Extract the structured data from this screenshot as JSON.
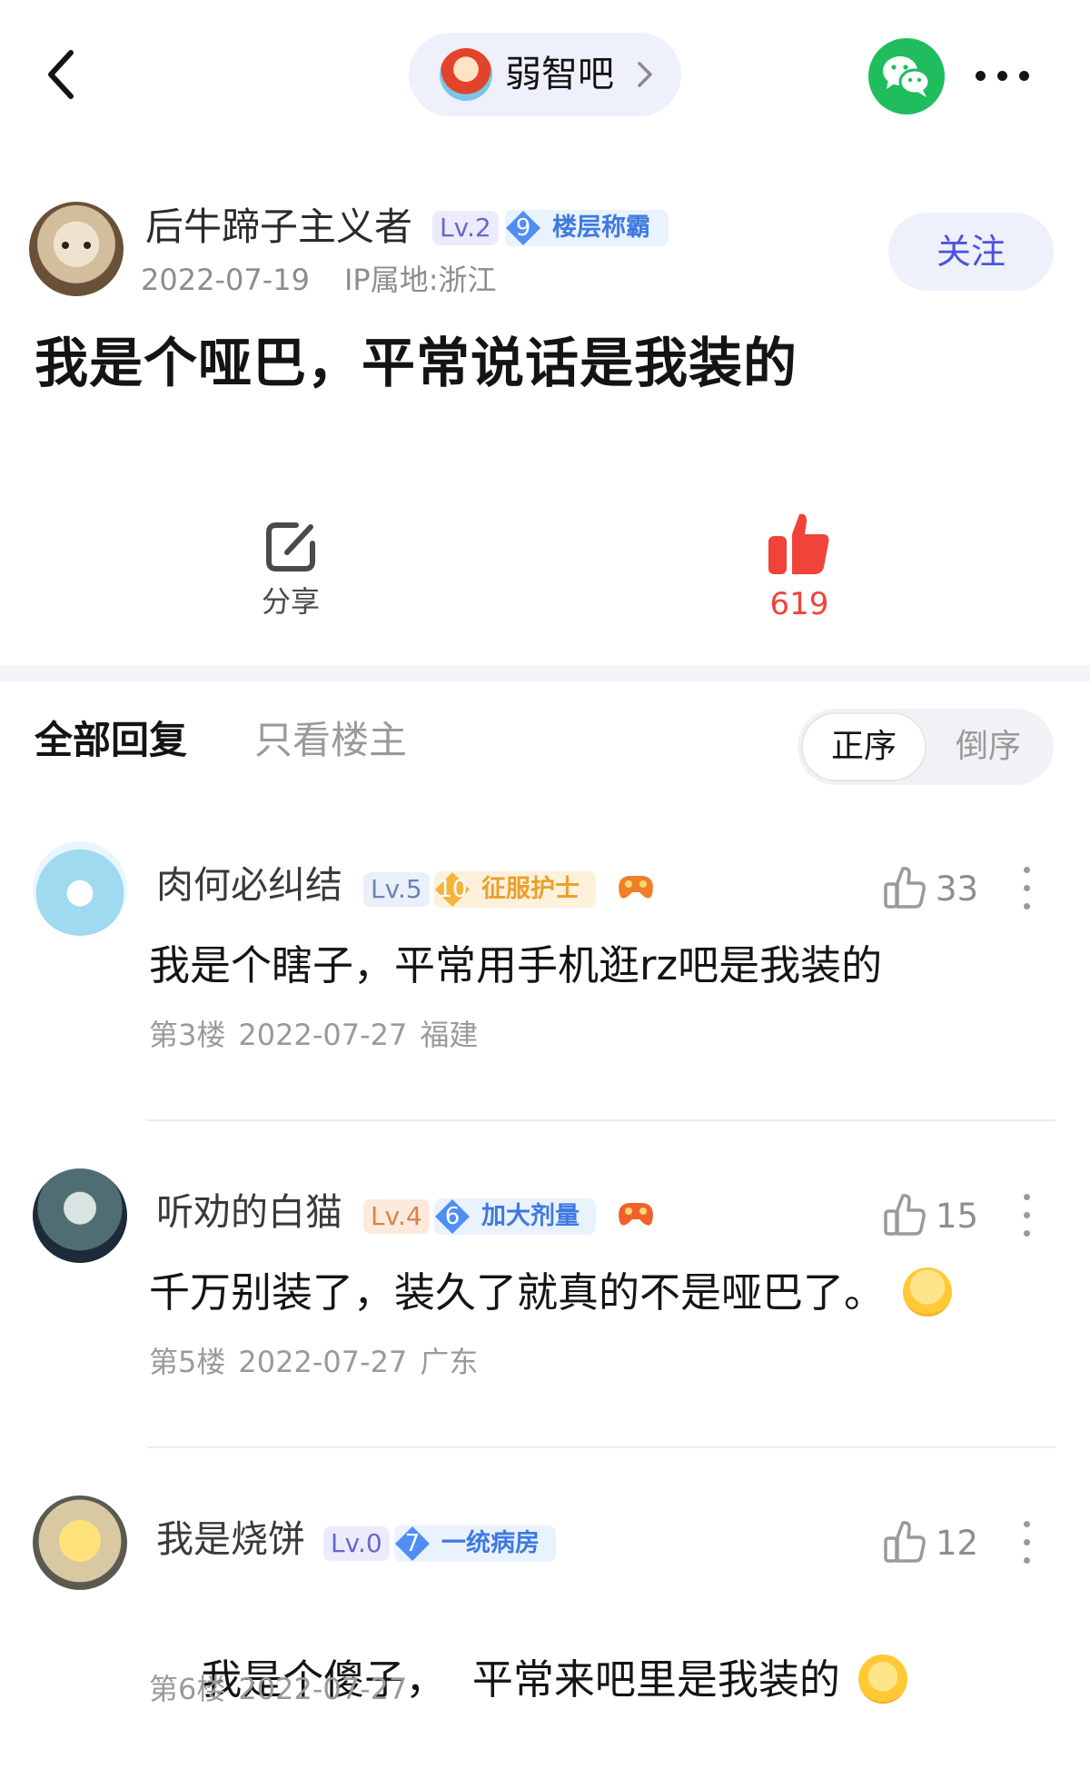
{
  "header": {
    "forum_name": "弱智吧",
    "icons": {
      "back": "back-arrow-icon",
      "share": "wechat-icon",
      "more": "more-dots-icon",
      "forum_chevron": "chevron-right-icon"
    }
  },
  "post": {
    "author": {
      "name": "后牛蹄子主义者",
      "level": "Lv.2",
      "badge_number": "9",
      "badge_title": "楼层称霸",
      "date": "2022-07-19",
      "ip_location": "IP属地:浙江"
    },
    "follow_label": "关注",
    "title": "我是个哑巴，平常说话是我装的",
    "share_label": "分享",
    "like_count": "619"
  },
  "tabs": {
    "all": "全部回复",
    "op_only": "只看楼主"
  },
  "sort": {
    "asc": "正序",
    "desc": "倒序",
    "selected": "正序"
  },
  "comments": [
    {
      "name": "肉何必纠结",
      "level": "Lv.5",
      "badge_number": "10",
      "badge_title": "征服护士",
      "likes": "33",
      "text": "我是个瞎子，平常用手机逛rz吧是我装的",
      "floor": "第3楼",
      "date": "2022-07-27",
      "location": "福建"
    },
    {
      "name": "听劝的白猫",
      "level": "Lv.4",
      "badge_number": "6",
      "badge_title": "加大剂量",
      "likes": "15",
      "text": "千万别装了，装久了就真的不是哑巴了。",
      "emoji": "flushed-face-emoji",
      "floor": "第5楼",
      "date": "2022-07-27",
      "location": "广东"
    },
    {
      "name": "我是烧饼",
      "level": "Lv.0",
      "badge_number": "7",
      "badge_title": "一统病房",
      "likes": "12",
      "text": "我是个傻子，  平常来吧里是我装的",
      "emoji": "woozy-face-emoji",
      "floor": "第6楼",
      "date": "2022-07-27",
      "location": ""
    }
  ],
  "colors": {
    "accent": "#4b55d8",
    "like_red": "#f0433a",
    "wechat_green": "#1fbd5e",
    "pill_bg": "#eef0fb",
    "divider": "#f3f4f7"
  }
}
